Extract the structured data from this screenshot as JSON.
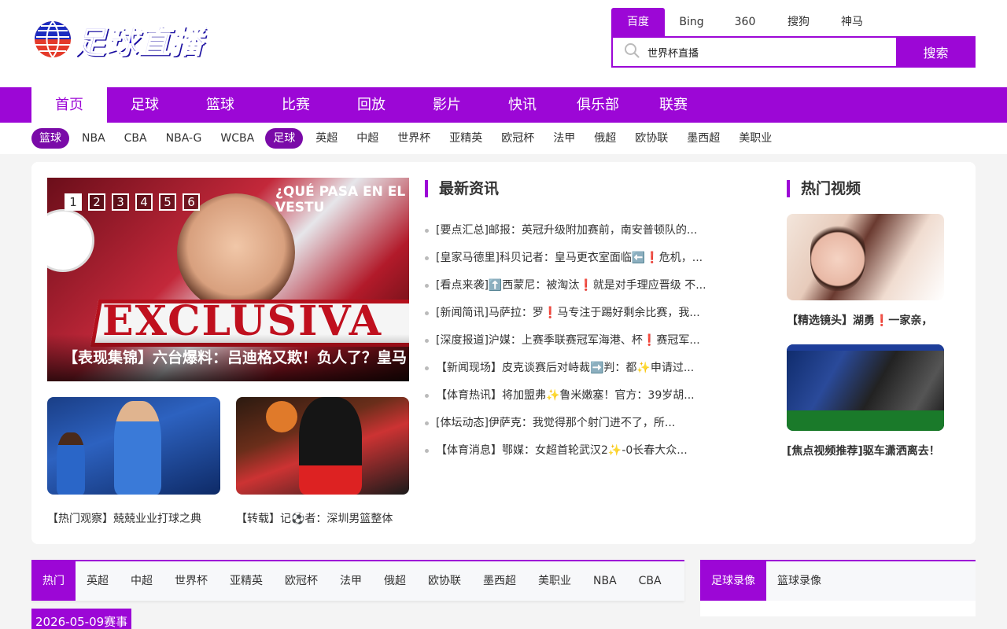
{
  "logo": {
    "text": "足球直播"
  },
  "search": {
    "engines": [
      "百度",
      "Bing",
      "360",
      "搜狗",
      "神马"
    ],
    "active_engine": 0,
    "query": "世界杯直播",
    "button_label": "搜索"
  },
  "main_nav": [
    "首页",
    "足球",
    "篮球",
    "比赛",
    "回放",
    "影片",
    "快讯",
    "俱乐部",
    "联赛"
  ],
  "sub_nav": {
    "basketball_label": "篮球",
    "basketball_items": [
      "NBA",
      "CBA",
      "NBA-G",
      "WCBA"
    ],
    "football_label": "足球",
    "football_items": [
      "英超",
      "中超",
      "世界杯",
      "亚精英",
      "欧冠杯",
      "法甲",
      "俄超",
      "欧协联",
      "墨西超",
      "美职业"
    ]
  },
  "slider": {
    "dots": [
      "1",
      "2",
      "3",
      "4",
      "5",
      "6"
    ],
    "top_text": "¿QUÉ PASA EN EL VESTU",
    "banner_text": "EXCLUSIVA",
    "caption": "【表现集锦】六台爆料：吕迪格又欺！负人了？皇马"
  },
  "thumbs": [
    {
      "caption": "【热门观察】兢兢业业打球之典"
    },
    {
      "caption": "【转载】记⚽者：深圳男篮整体"
    }
  ],
  "news": {
    "title": "最新资讯",
    "items": [
      "[要点汇总]邮报：英冠升级附加赛前，南安普顿队的...",
      "[皇家马德里]科贝记者：皇马更衣室面临⬅️❗危机，...",
      "[看点来袭]⬆️西蒙尼：被淘汰❗就是对手理应晋级 不...",
      "[新闻简讯]马萨拉：罗❗马专注于踢好剩余比赛，我...",
      "[深度报道]沪媒：上赛季联赛冠军海港、杯❗赛冠军...",
      "【新闻现场】皮克谈赛后对峙裁➡️判：都✨申请过...",
      "【体育热讯】将加盟弗✨鲁米嫩塞！官方：39岁胡...",
      "[体坛动态]伊萨克：我觉得那个射门进不了，所...",
      "【体育消息】鄂媒：女超首轮武汉2✨-0长春大众..."
    ]
  },
  "videos": {
    "title": "热门视频",
    "items": [
      {
        "caption": "【精选镜头】湖勇❗一家亲，"
      },
      {
        "caption": "[焦点视频推荐]驱车潇洒离去！"
      }
    ]
  },
  "bottom_tabs": [
    "热门",
    "英超",
    "中超",
    "世界杯",
    "亚精英",
    "欧冠杯",
    "法甲",
    "俄超",
    "欧协联",
    "墨西超",
    "美职业",
    "NBA",
    "CBA"
  ],
  "record_tabs": [
    "足球录像",
    "篮球录像"
  ],
  "date_tag": "2026-05-09赛事",
  "colors": {
    "accent": "#9c07d6",
    "pill": "#7a0aa8",
    "logo_blue": "#2a16d8"
  }
}
